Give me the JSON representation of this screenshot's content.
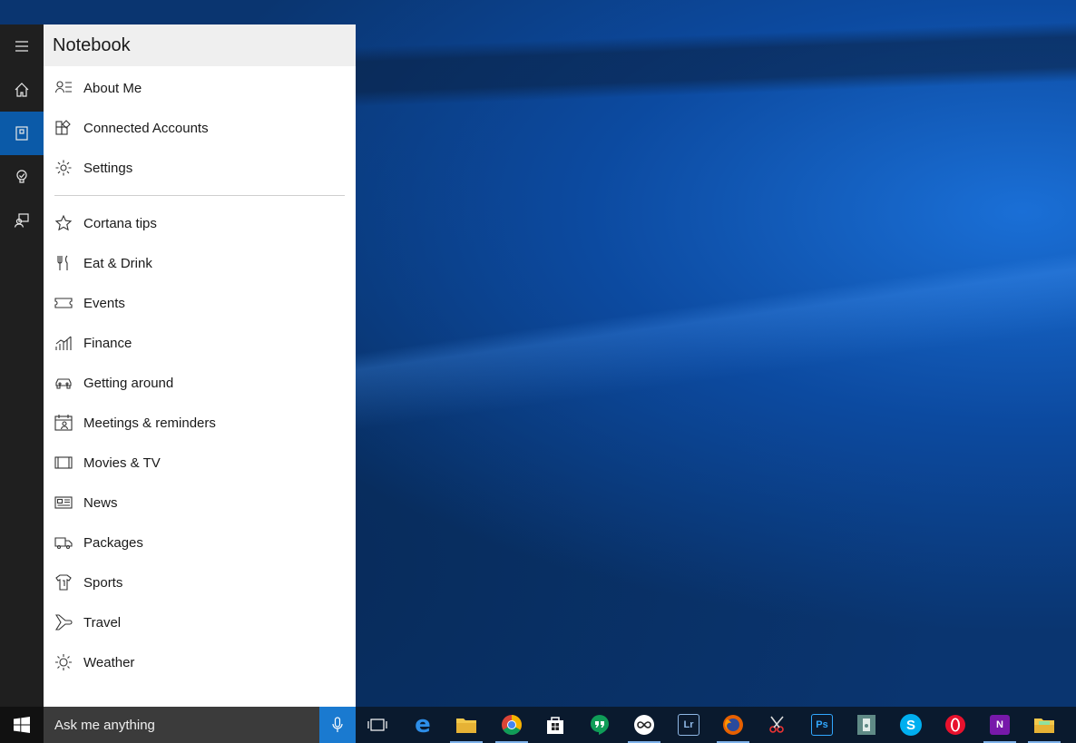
{
  "panel": {
    "title": "Notebook",
    "items_top": [
      {
        "label": "About Me",
        "icon": "person-list-icon"
      },
      {
        "label": "Connected Accounts",
        "icon": "connected-accounts-icon"
      },
      {
        "label": "Settings",
        "icon": "gear-icon"
      }
    ],
    "items": [
      {
        "label": "Cortana tips",
        "icon": "star-icon"
      },
      {
        "label": "Eat & Drink",
        "icon": "fork-knife-icon"
      },
      {
        "label": "Events",
        "icon": "ticket-icon"
      },
      {
        "label": "Finance",
        "icon": "finance-chart-icon"
      },
      {
        "label": "Getting around",
        "icon": "car-icon"
      },
      {
        "label": "Meetings & reminders",
        "icon": "calendar-person-icon"
      },
      {
        "label": "Movies & TV",
        "icon": "film-icon"
      },
      {
        "label": "News",
        "icon": "newspaper-icon"
      },
      {
        "label": "Packages",
        "icon": "truck-icon"
      },
      {
        "label": "Sports",
        "icon": "jersey-icon"
      },
      {
        "label": "Travel",
        "icon": "airplane-icon"
      },
      {
        "label": "Weather",
        "icon": "sun-icon"
      }
    ]
  },
  "rail": [
    {
      "icon": "hamburger-menu-icon",
      "active": false
    },
    {
      "icon": "home-icon",
      "active": false
    },
    {
      "icon": "notebook-icon",
      "active": true
    },
    {
      "icon": "lightbulb-icon",
      "active": false
    },
    {
      "icon": "feedback-icon",
      "active": false
    }
  ],
  "taskbar": {
    "search_placeholder": "Ask me anything",
    "apps": [
      {
        "icon": "task-view-icon"
      },
      {
        "icon": "edge-icon"
      },
      {
        "icon": "file-explorer-icon"
      },
      {
        "icon": "chrome-icon"
      },
      {
        "icon": "store-icon"
      },
      {
        "icon": "hangouts-icon"
      },
      {
        "icon": "infinity-app-icon"
      },
      {
        "icon": "lightroom-icon",
        "text": "Lr"
      },
      {
        "icon": "firefox-icon"
      },
      {
        "icon": "snipping-tool-icon"
      },
      {
        "icon": "photoshop-icon",
        "text": "Ps"
      },
      {
        "icon": "document-app-icon"
      },
      {
        "icon": "skype-icon",
        "text": "S"
      },
      {
        "icon": "opera-icon"
      },
      {
        "icon": "onenote-icon",
        "text": "N"
      },
      {
        "icon": "sticky-notes-icon"
      }
    ]
  },
  "colors": {
    "accent": "#0b5aa8",
    "mic": "#1a7ad0",
    "rail": "#1f1f1f",
    "search": "#3b3b3b"
  }
}
